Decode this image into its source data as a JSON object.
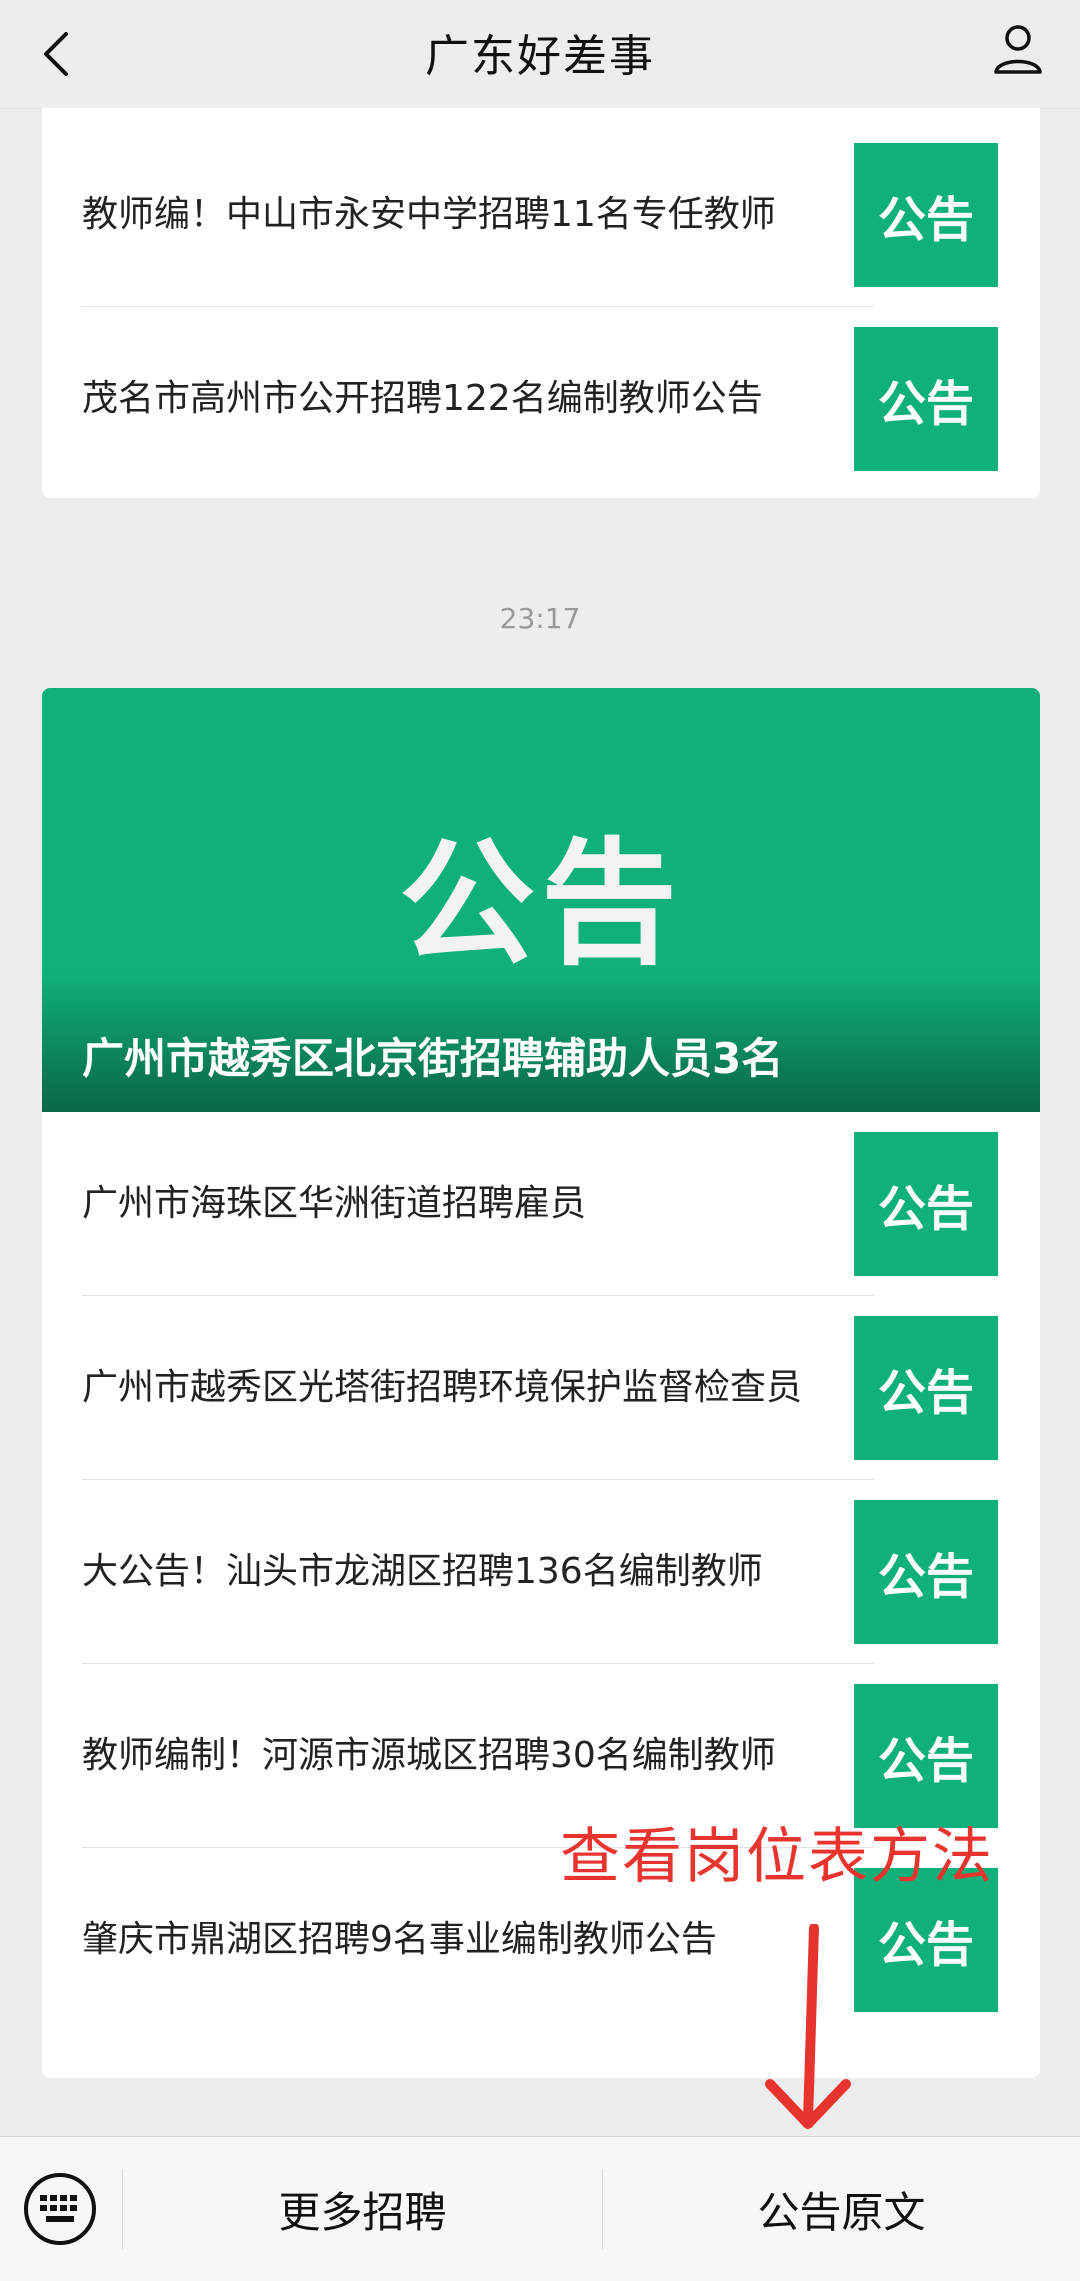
{
  "header": {
    "title": "广东好差事"
  },
  "card1": {
    "items": [
      {
        "title": "教师编！中山市永安中学招聘11名专任教师",
        "thumb": "公告"
      },
      {
        "title": "茂名市高州市公开招聘122名编制教师公告",
        "thumb": "公告"
      }
    ]
  },
  "timestamp": "23:17",
  "card2": {
    "hero": {
      "big_text": "公告",
      "caption": "广州市越秀区北京街招聘辅助人员3名"
    },
    "items": [
      {
        "title": "广州市海珠区华洲街道招聘雇员",
        "thumb": "公告"
      },
      {
        "title": "广州市越秀区光塔街招聘环境保护监督检查员",
        "thumb": "公告"
      },
      {
        "title": "大公告！汕头市龙湖区招聘136名编制教师",
        "thumb": "公告"
      },
      {
        "title": "教师编制！河源市源城区招聘30名编制教师",
        "thumb": "公告"
      },
      {
        "title": "肇庆市鼎湖区招聘9名事业编制教师公告",
        "thumb": "公告"
      }
    ]
  },
  "overlay": {
    "text": "查看岗位表方法"
  },
  "bottom_menu": {
    "more_jobs": "更多招聘",
    "original_notice": "公告原文"
  },
  "colors": {
    "accent": "#10b07a",
    "annotation": "#e8342e"
  }
}
